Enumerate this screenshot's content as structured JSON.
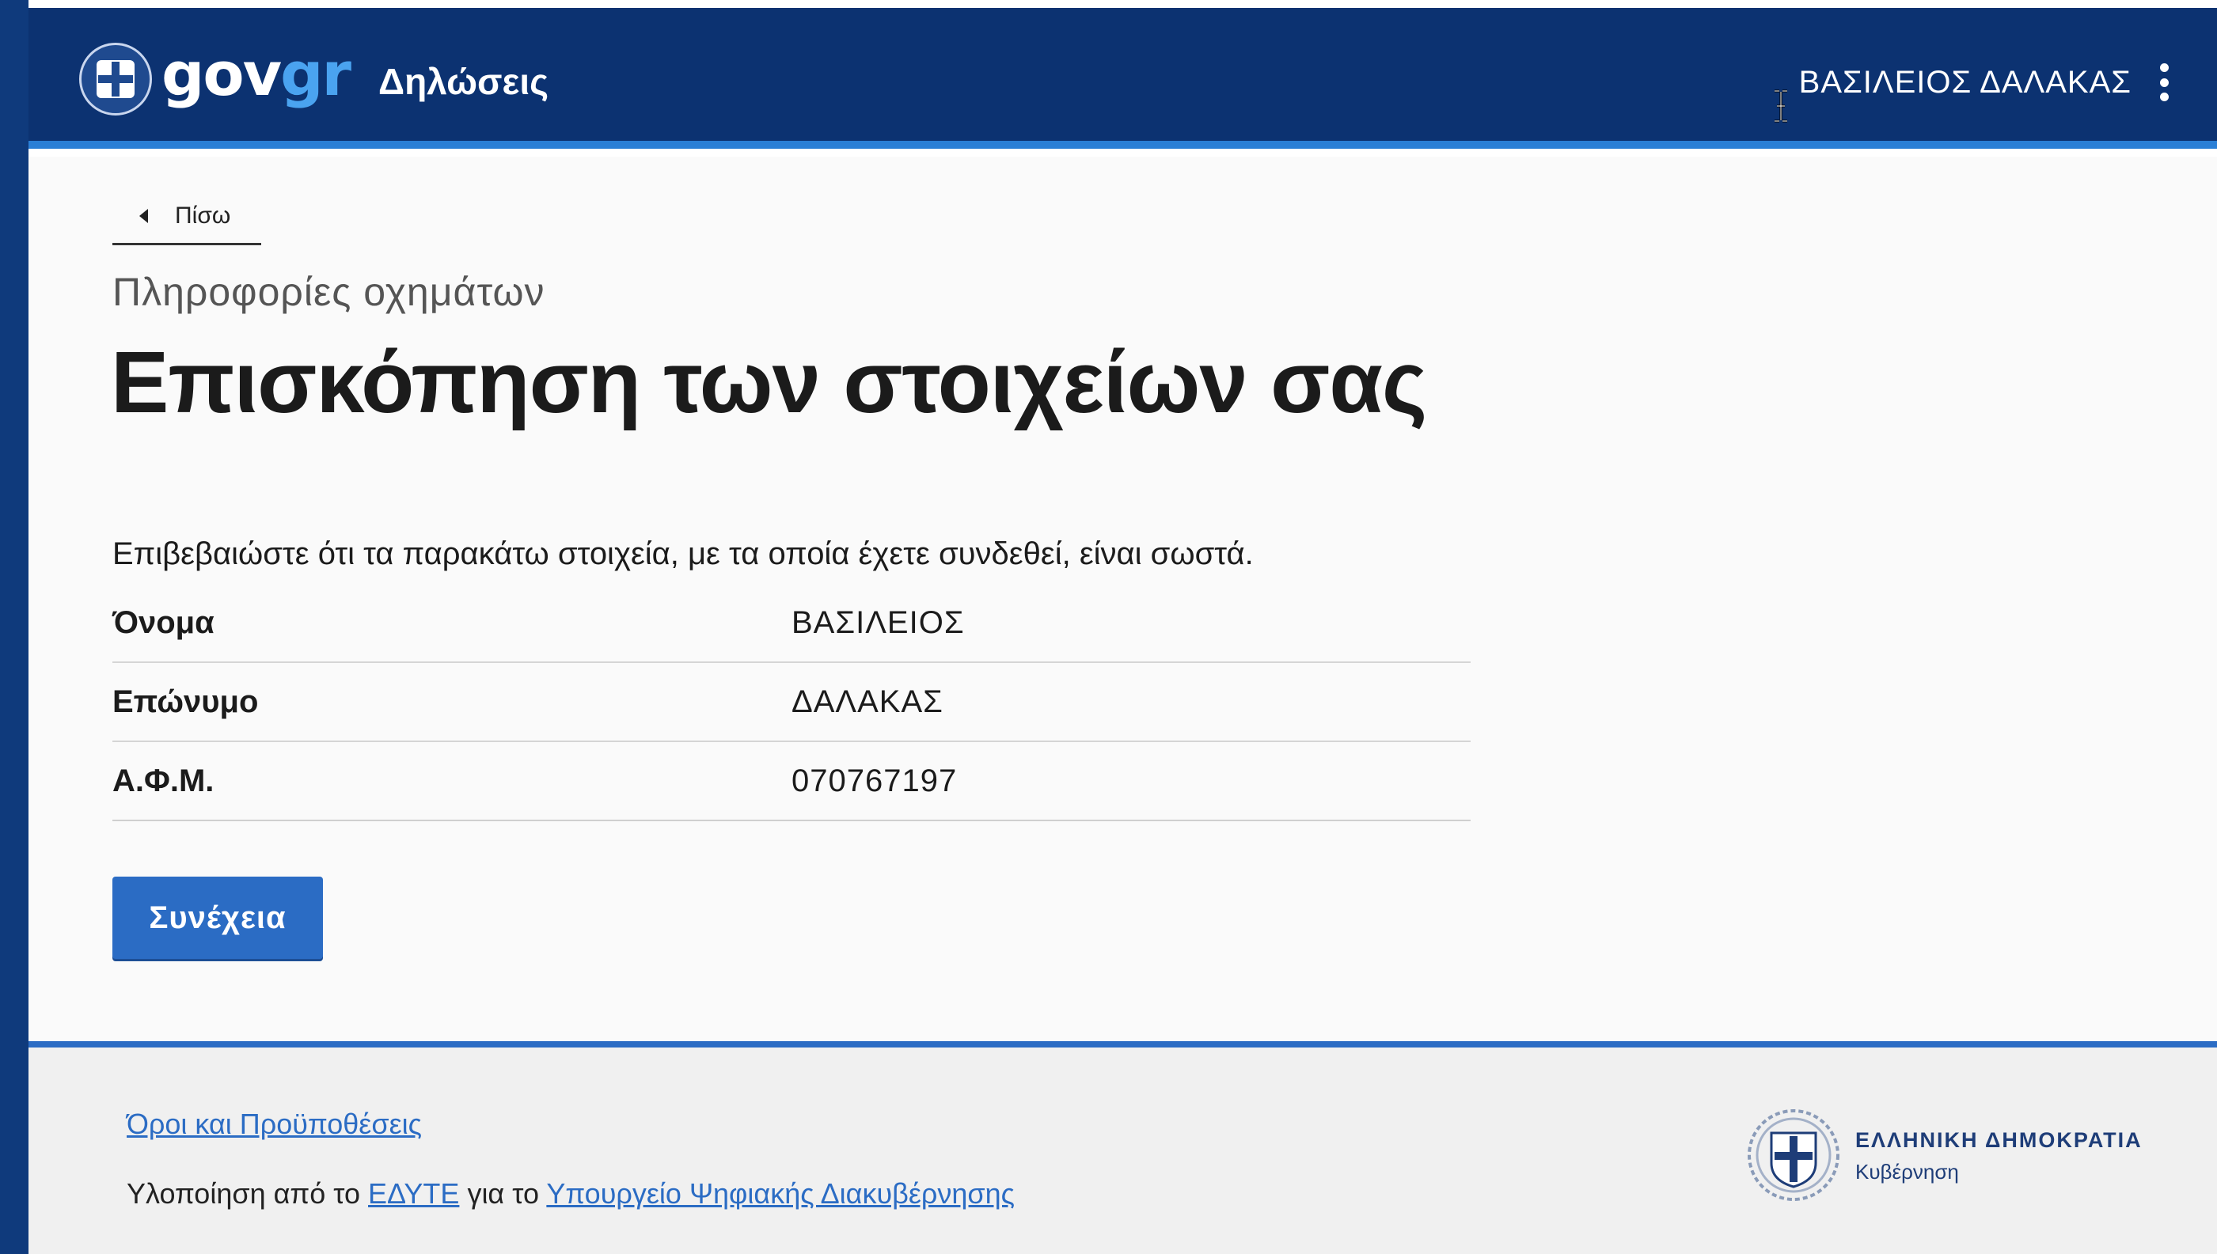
{
  "header": {
    "logo_gov": "gov",
    "logo_gr": "gr",
    "app_title": "Δηλώσεις",
    "user_name": "ΒΑΣΙΛΕΙΟΣ ΔΑΛΑΚΑΣ"
  },
  "nav": {
    "back_label": "Πίσω"
  },
  "page": {
    "caption": "Πληροφορίες οχημάτων",
    "title": "Επισκόπηση των στοιχείων σας",
    "intro": "Επιβεβαιώστε ότι τα παρακάτω στοιχεία, με τα οποία έχετε συνδεθεί, είναι σωστά."
  },
  "details": [
    {
      "label": "Όνομα",
      "value": "ΒΑΣΙΛΕΙΟΣ"
    },
    {
      "label": "Επώνυμο",
      "value": "ΔΑΛΑΚΑΣ"
    },
    {
      "label": "Α.Φ.Μ.",
      "value": "070767197"
    }
  ],
  "actions": {
    "continue_label": "Συνέχεια"
  },
  "footer": {
    "terms_label": "Όροι και Προϋποθέσεις",
    "credit_prefix": "Υλοποίηση από το",
    "credit_org": "ΕΔΥΤΕ",
    "credit_mid": "για το",
    "credit_ministry": "Υπουργείο Ψηφιακής Διακυβέρνησης",
    "gov_name": "ΕΛΛΗΝΙΚΗ ΔΗΜΟΚΡΑΤΙΑ",
    "gov_sub": "Κυβέρνηση"
  },
  "colors": {
    "header_bg": "#0c3271",
    "accent": "#2b6cc4",
    "logo_gr": "#4aa3f0"
  }
}
